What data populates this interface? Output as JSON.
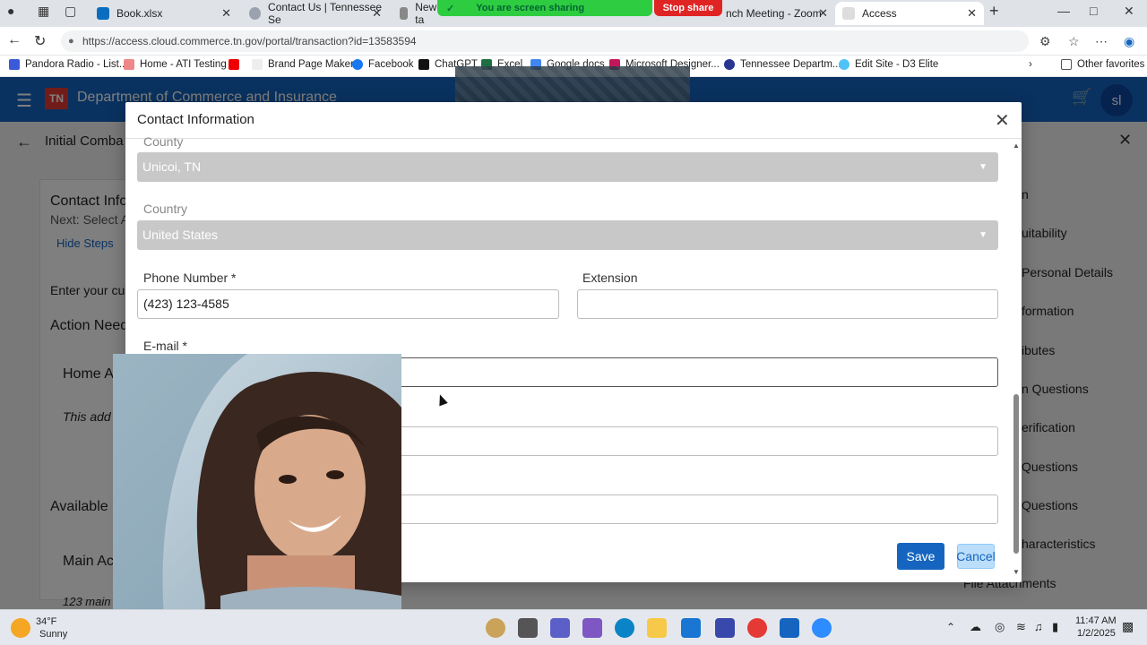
{
  "browser": {
    "tabs": [
      {
        "label": "Book.xlsx"
      },
      {
        "label": "Contact Us | Tennessee Se"
      },
      {
        "label": "New ta"
      },
      {
        "label": "nch Meeting - Zoom"
      },
      {
        "label": "Access"
      }
    ],
    "screen_share_text": "You are screen sharing",
    "stop_share_label": "Stop share",
    "url": "https://access.cloud.commerce.tn.gov/portal/transaction?id=13583594",
    "bookmarks": [
      "Pandora Radio - List...",
      "Home - ATI Testing",
      "",
      "Brand Page Maker",
      "Facebook",
      "ChatGPT",
      "Excel",
      "Google docs",
      "Microsoft Designer...",
      "Tennessee Departm...",
      "Edit Site - D3 Elite"
    ],
    "other_favorites": "Other favorites"
  },
  "app": {
    "logo_text": "TN",
    "title": "Department of Commerce and Insurance",
    "avatar_initials": "sl"
  },
  "background_page": {
    "title": "Initial Comba",
    "texts": [
      "Contact Info",
      "Next: Select A",
      "Hide Steps",
      "Enter your cur",
      "Action Need",
      "Home A",
      "This add",
      "Available",
      "Main Ac",
      "123 main"
    ],
    "steps": [
      "n",
      "uitability",
      "Personal Details",
      "formation",
      "ibutes",
      "n Questions",
      "erification",
      "Questions",
      "Questions",
      "haracteristics",
      "File Attachments"
    ]
  },
  "modal": {
    "title": "Contact Information",
    "county_label": "County",
    "county_value": "Unicoi, TN",
    "country_label": "Country",
    "country_value": "United States",
    "phone_label": "Phone Number *",
    "phone_value": "(423) 123-4585",
    "extension_label": "Extension",
    "extension_value": "",
    "email_label": "E-mail *",
    "save_label": "Save",
    "cancel_label": "Cancel"
  },
  "taskbar": {
    "weather_temp": "34°F",
    "weather_desc": "Sunny",
    "time": "11:47 AM",
    "date": "1/2/2025"
  }
}
